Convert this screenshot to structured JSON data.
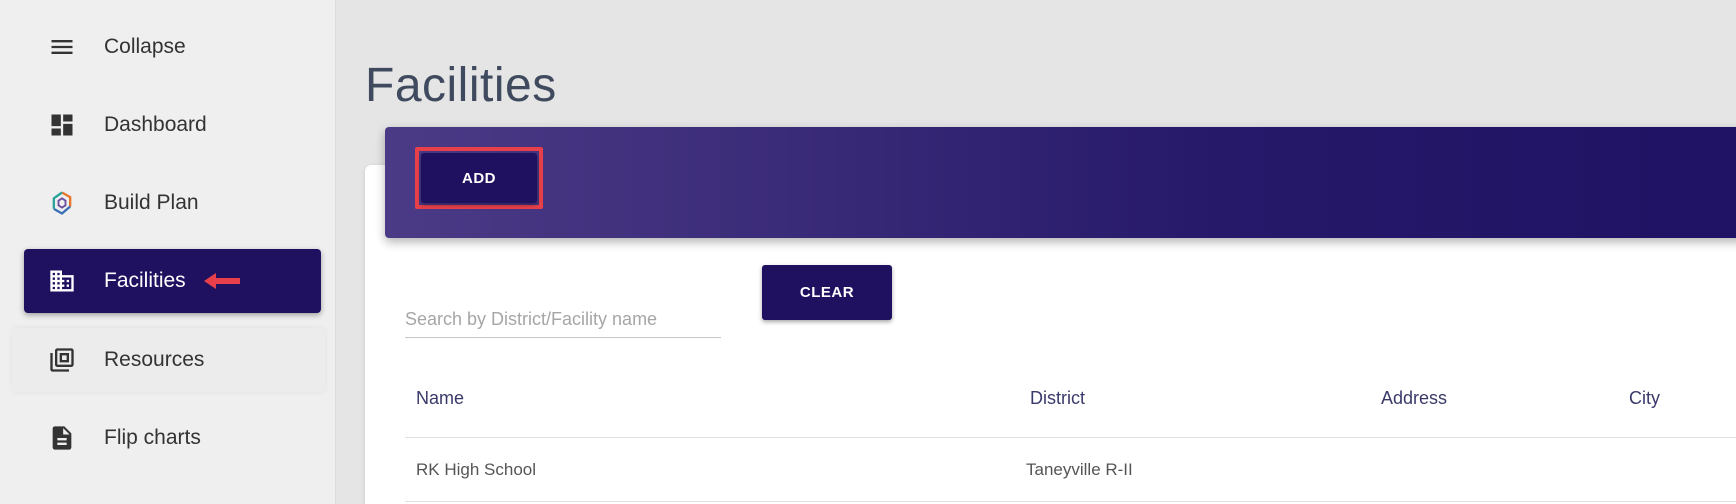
{
  "sidebar": {
    "items": [
      {
        "label": "Collapse",
        "icon": "menu-icon"
      },
      {
        "label": "Dashboard",
        "icon": "dashboard-icon"
      },
      {
        "label": "Build Plan",
        "icon": "build-plan-logo-icon"
      },
      {
        "label": "Facilities",
        "icon": "building-icon",
        "active": true
      },
      {
        "label": "Resources",
        "icon": "library-icon"
      },
      {
        "label": "Flip charts",
        "icon": "document-icon"
      }
    ]
  },
  "main": {
    "title": "Facilities",
    "add_label": "ADD",
    "clear_label": "CLEAR",
    "search_placeholder": "Search by District/Facility name",
    "table": {
      "columns": [
        "Name",
        "District",
        "Address",
        "City"
      ],
      "rows": [
        [
          "RK High School",
          "Taneyville R-II",
          "",
          ""
        ]
      ]
    }
  },
  "colors": {
    "primary": "#1f1060",
    "highlight": "#e8404a",
    "arrow": "#e8404a"
  }
}
